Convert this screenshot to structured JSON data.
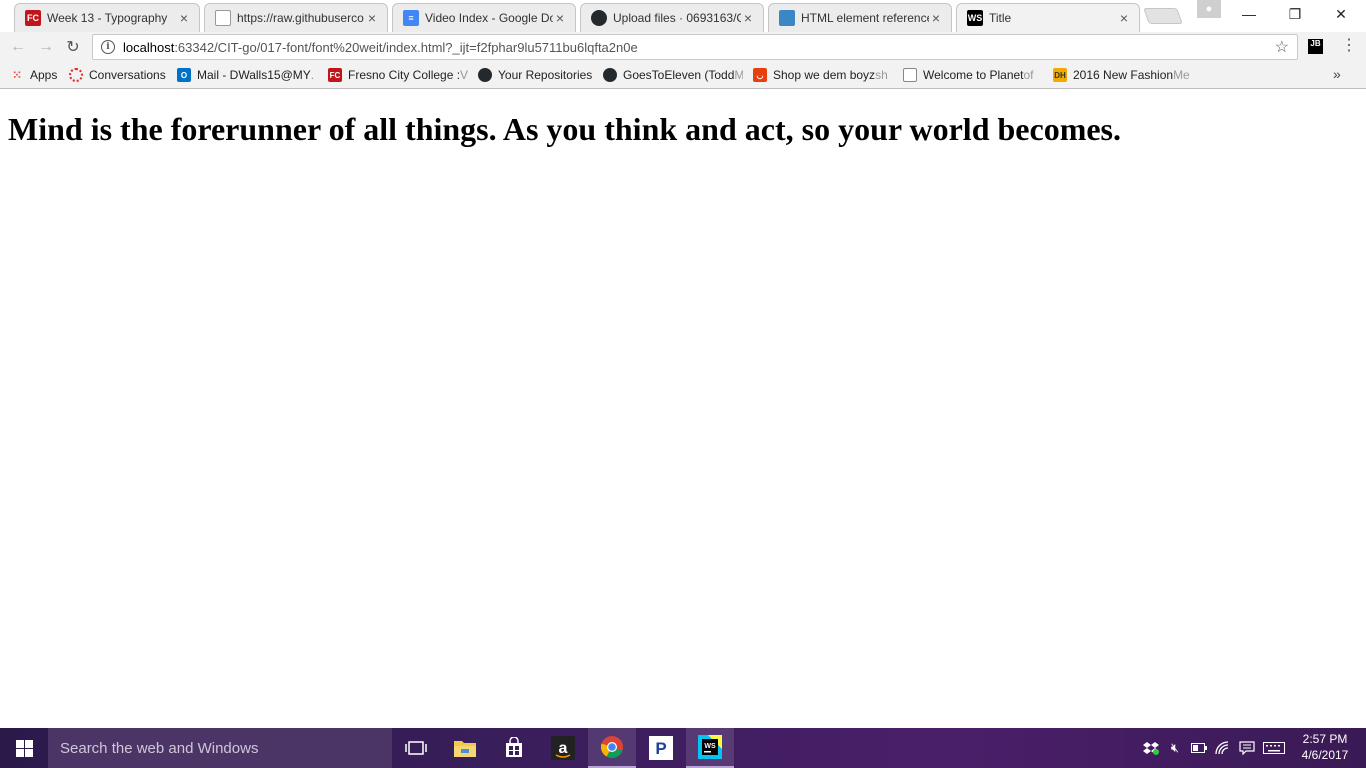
{
  "browser": {
    "tabs": [
      {
        "title": "Week 13 - Typography",
        "icon": "fresno-city-college-icon",
        "color": "#c0161b",
        "active": false
      },
      {
        "title": "https://raw.githubuserco",
        "icon": "document-icon",
        "color": "#777777",
        "active": false
      },
      {
        "title": "Video Index - Google Do",
        "icon": "google-docs-icon",
        "color": "#4285f4",
        "active": false
      },
      {
        "title": "Upload files · 0693163/C",
        "icon": "github-icon",
        "color": "#24292e",
        "active": false
      },
      {
        "title": "HTML element reference",
        "icon": "mdn-icon",
        "color": "#3b86c4",
        "active": false
      },
      {
        "title": "Title",
        "icon": "webstorm-icon",
        "color": "#000000",
        "active": true
      }
    ],
    "window_controls": {
      "minimize": "—",
      "maximize": "❐",
      "close": "✕"
    },
    "address": {
      "host": "localhost",
      "rest": ":63342/CIT-go/017-font/font%20weit/index.html?_ijt=f2fphar9lu5711bu6lqfta2n0e"
    },
    "extension_label": "JB",
    "bookmarks": [
      {
        "label": "Apps",
        "icon": "apps-grid-icon",
        "color": "#e84c3d"
      },
      {
        "label": "Conversations",
        "icon": "conversations-icon",
        "color": "#d93025"
      },
      {
        "label": "Mail - DWalls15@MY",
        "fade": ".",
        "icon": "outlook-icon",
        "color": "#0072c6"
      },
      {
        "label": "Fresno City College : ",
        "fade": "V",
        "icon": "fresno-city-college-icon",
        "color": "#c0161b"
      },
      {
        "label": "Your Repositories",
        "icon": "github-icon",
        "color": "#24292e"
      },
      {
        "label": "GoesToEleven (Todd ",
        "fade": "M",
        "icon": "github-icon",
        "color": "#24292e"
      },
      {
        "label": "Shop we dem boyz ",
        "fade": "sh",
        "icon": "shop-icon",
        "color": "#e8400c"
      },
      {
        "label": "Welcome to Planet ",
        "fade": "of",
        "icon": "document-icon",
        "color": "#777777"
      },
      {
        "label": "2016 New Fashion ",
        "fade": "Me",
        "icon": "dh-icon",
        "color": "#f2a900"
      }
    ]
  },
  "page": {
    "quote": "Mind is the forerunner of all things. As you think and act, so your world becomes."
  },
  "taskbar": {
    "search_placeholder": "Search the web and Windows",
    "time": "2:57 PM",
    "date": "4/6/2017"
  }
}
